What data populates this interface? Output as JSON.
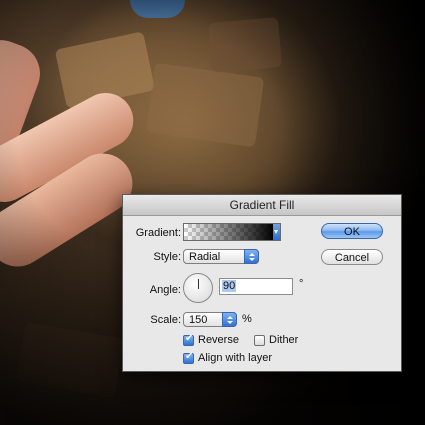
{
  "dialog": {
    "title": "Gradient Fill",
    "gradient_label": "Gradient:",
    "style_label": "Style:",
    "style_value": "Radial",
    "angle_label": "Angle:",
    "angle_value": "90",
    "angle_unit": "°",
    "scale_label": "Scale:",
    "scale_value": "150",
    "scale_unit": "%",
    "reverse_label": "Reverse",
    "reverse_checked": true,
    "dither_label": "Dither",
    "dither_checked": false,
    "align_label": "Align with layer",
    "align_checked": true,
    "ok_label": "OK",
    "cancel_label": "Cancel"
  },
  "icons": {
    "gradient_dropdown": "chevron-down-icon",
    "angle_dial": "angle-dial-icon"
  },
  "colors": {
    "accent": "#2f72d6",
    "dialog_bg": "#e8e8e8"
  }
}
